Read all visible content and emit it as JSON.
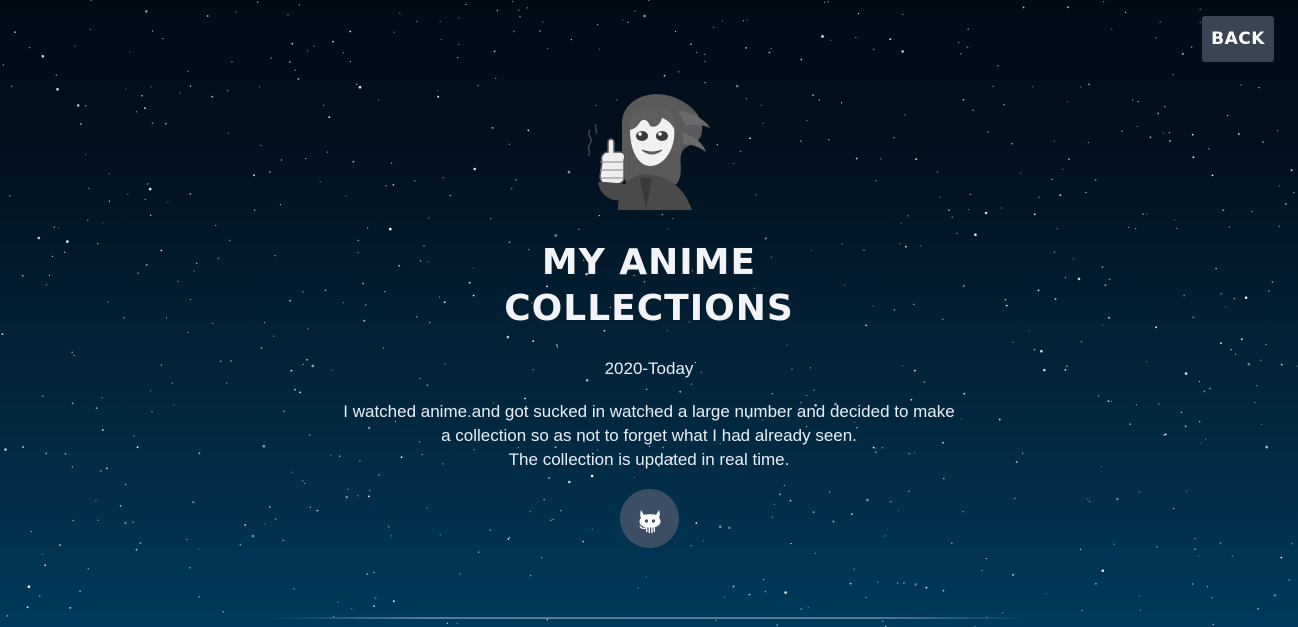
{
  "header": {
    "back_label": "BACK"
  },
  "hero": {
    "avatar_icon": "anime-girl-thumbs-up-icon",
    "title_line1": "MY ANIME",
    "title_line2": "COLLECTIONS",
    "years": "2020-Today",
    "description": [
      "I watched anime and got sucked in watched a large number and decided to make",
      "a collection so as not to forget what I had already seen.",
      "The collection is updated in real time."
    ],
    "github_icon": "github-icon"
  },
  "colors": {
    "background_top": "#000b16",
    "background_bottom": "#003a5c",
    "button_bg": "#3a4554",
    "github_bg": "#3b4e63",
    "text": "#eef2f6"
  }
}
